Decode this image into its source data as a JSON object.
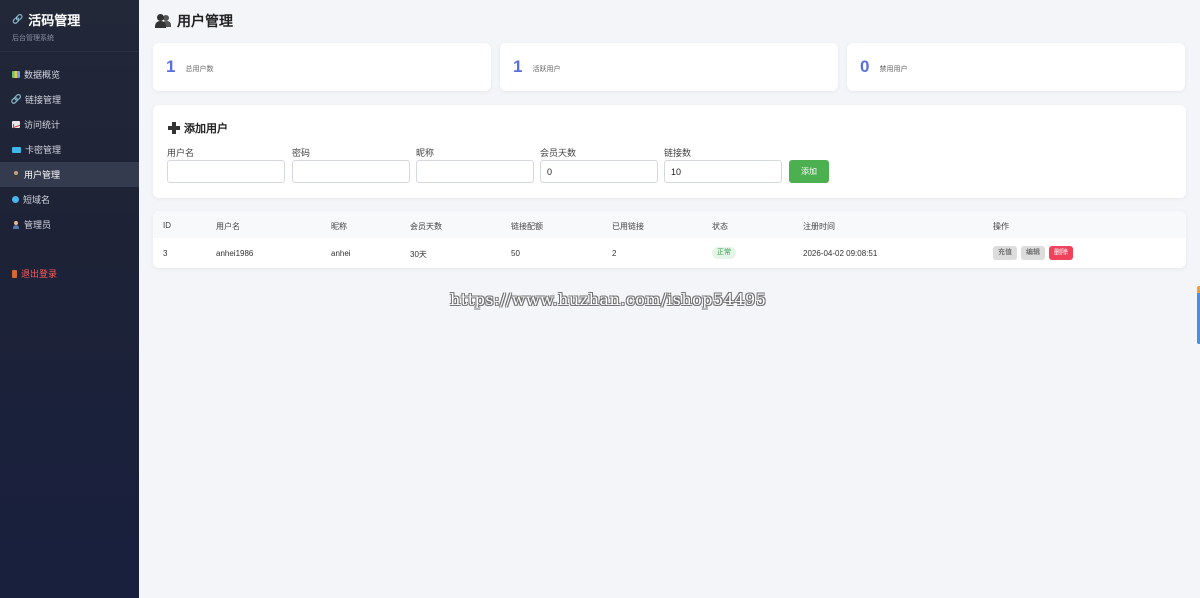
{
  "brand": {
    "title": "活码管理",
    "subtitle": "后台管理系统"
  },
  "nav": {
    "items": [
      {
        "label": "数据概览"
      },
      {
        "label": "链接管理"
      },
      {
        "label": "访问统计"
      },
      {
        "label": "卡密管理"
      },
      {
        "label": "用户管理"
      },
      {
        "label": "短域名"
      },
      {
        "label": "管理员"
      }
    ],
    "logout": "退出登录"
  },
  "page": {
    "title": "用户管理"
  },
  "stats": [
    {
      "value": "1",
      "label": "总用户数"
    },
    {
      "value": "1",
      "label": "活跃用户"
    },
    {
      "value": "0",
      "label": "禁用用户"
    }
  ],
  "form": {
    "title": "添加用户",
    "fields": [
      {
        "label": "用户名",
        "value": ""
      },
      {
        "label": "密码",
        "value": ""
      },
      {
        "label": "昵称",
        "value": ""
      },
      {
        "label": "会员天数",
        "value": "0"
      },
      {
        "label": "链接数",
        "value": "10"
      }
    ],
    "submit": "添加"
  },
  "table": {
    "headers": [
      "ID",
      "用户名",
      "昵称",
      "会员天数",
      "链接配额",
      "已用链接",
      "状态",
      "注册时间",
      "操作"
    ],
    "rows": [
      {
        "id": "3",
        "username": "anhei1986",
        "nickname": "anhei",
        "days": "30天",
        "quota": "50",
        "used": "2",
        "status": "正常",
        "registered": "2026-04-02 09:08:51",
        "actions": [
          "充值",
          "编辑",
          "删除"
        ]
      }
    ]
  },
  "watermark": "https://www.huzhan.com/ishop54495",
  "colors": {
    "accent": "#5b6ee1",
    "success": "#4caf50",
    "danger": "#f0425c",
    "sidebar": "#1d2236"
  }
}
